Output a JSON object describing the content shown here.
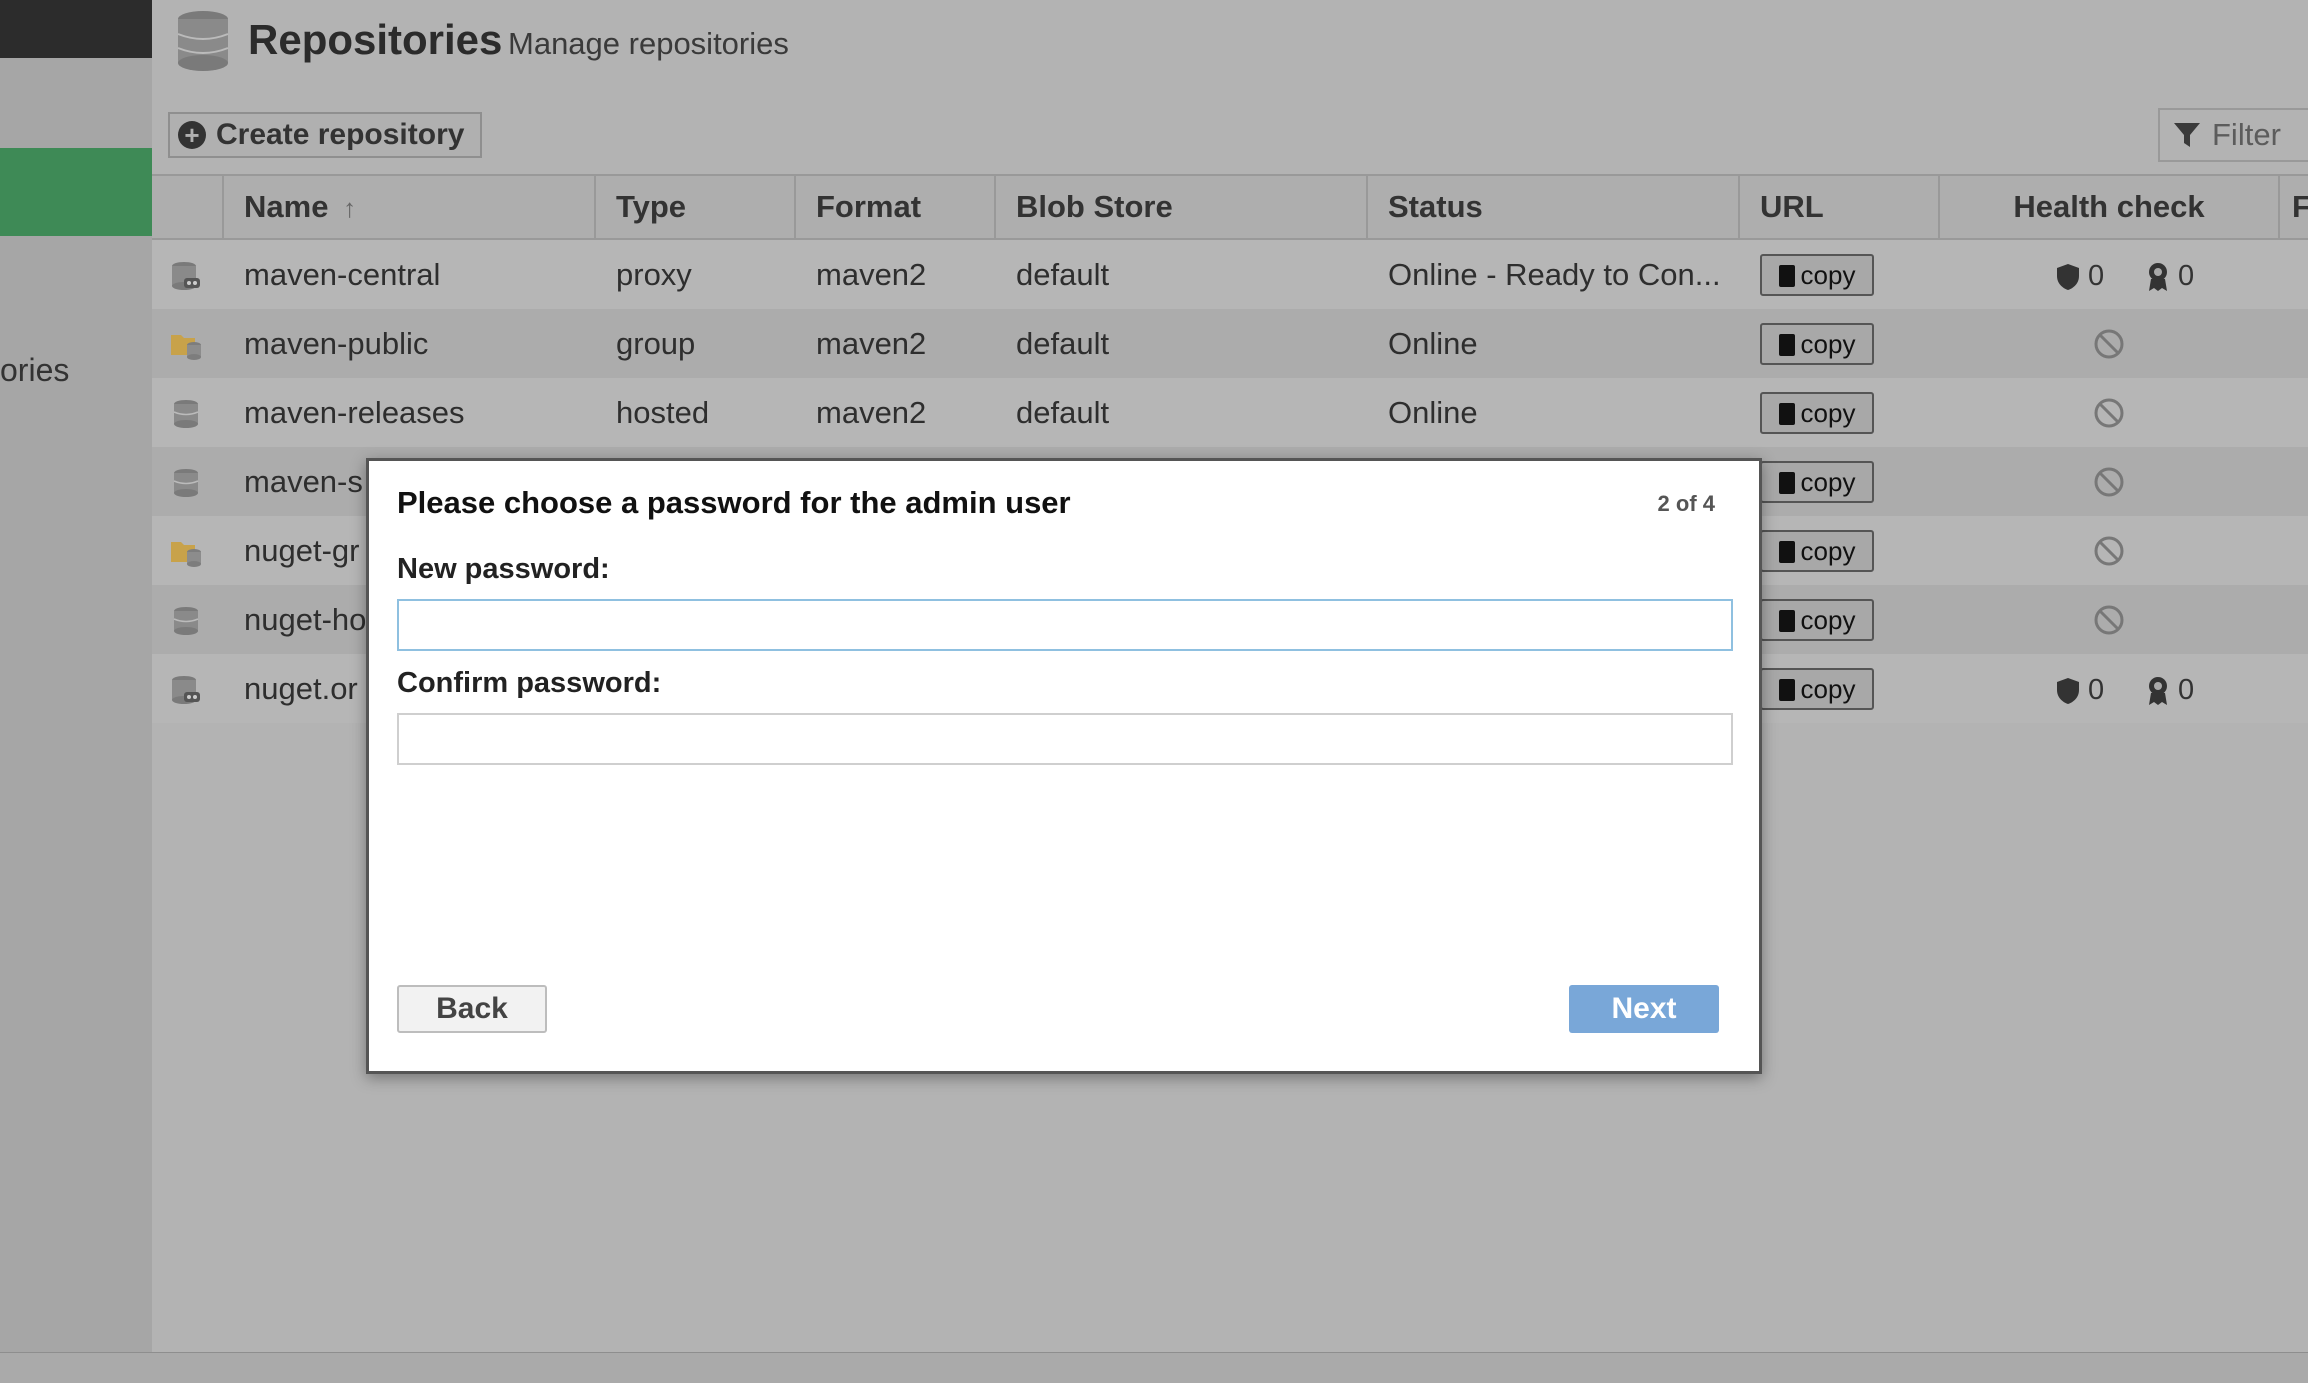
{
  "sidebar": {
    "partial_label": "ories"
  },
  "header": {
    "title": "Repositories",
    "subtitle": "Manage repositories",
    "icon": "database-icon"
  },
  "toolbar": {
    "create_label": "Create repository",
    "filter_placeholder": "Filter"
  },
  "grid": {
    "columns": [
      "Name",
      "Type",
      "Format",
      "Blob Store",
      "Status",
      "URL",
      "Health check",
      "F"
    ],
    "sort": {
      "column": "Name",
      "direction": "ascending"
    },
    "rows": [
      {
        "name": "maven-central",
        "type": "proxy",
        "format": "maven2",
        "blob_store": "default",
        "status": "Online - Ready to Con...",
        "url_button": "copy",
        "icon": "proxy-repo-icon",
        "health": {
          "security": "0",
          "license": "0"
        }
      },
      {
        "name": "maven-public",
        "type": "group",
        "format": "maven2",
        "blob_store": "default",
        "status": "Online",
        "url_button": "copy",
        "icon": "group-repo-icon",
        "health": null
      },
      {
        "name": "maven-releases",
        "type": "hosted",
        "format": "maven2",
        "blob_store": "default",
        "status": "Online",
        "url_button": "copy",
        "icon": "hosted-repo-icon",
        "health": null
      },
      {
        "name": "maven-s",
        "type": "",
        "format": "",
        "blob_store": "",
        "status": "",
        "url_button": "copy",
        "icon": "hosted-repo-icon",
        "health": null
      },
      {
        "name": "nuget-gr",
        "type": "",
        "format": "",
        "blob_store": "",
        "status": "",
        "url_button": "copy",
        "icon": "group-repo-icon",
        "health": null
      },
      {
        "name": "nuget-ho",
        "type": "",
        "format": "",
        "blob_store": "",
        "status": "",
        "url_button": "copy",
        "icon": "hosted-repo-icon",
        "health": null
      },
      {
        "name": "nuget.or",
        "type": "",
        "format": "",
        "blob_store": "",
        "status": "",
        "url_button": "copy",
        "icon": "proxy-repo-icon",
        "health": {
          "security": "0",
          "license": "0"
        }
      }
    ]
  },
  "modal": {
    "title": "Please choose a password for the admin user",
    "step": "2 of 4",
    "new_password_label": "New password:",
    "new_password_value": "",
    "confirm_password_label": "Confirm password:",
    "confirm_password_value": "",
    "back_label": "Back",
    "next_label": "Next"
  },
  "colors": {
    "sidebar_active": "#3e8a56",
    "next_button": "#79a7d8",
    "input_focus": "#8fc0e0"
  }
}
